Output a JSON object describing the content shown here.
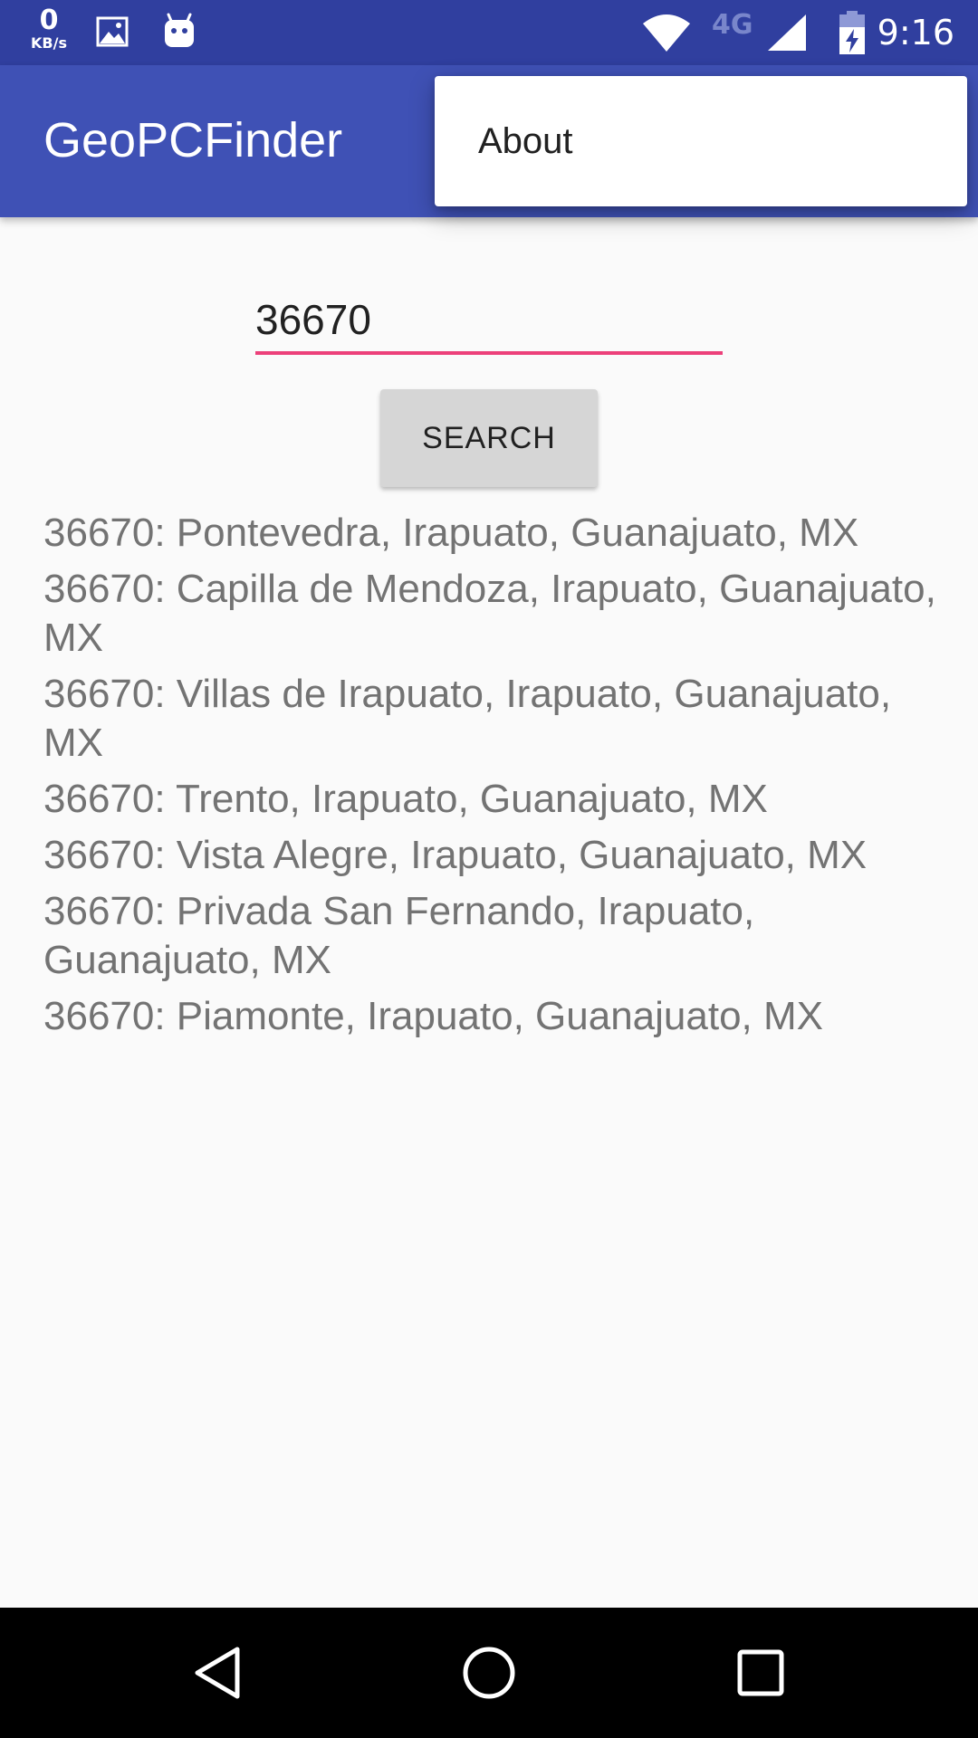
{
  "status_bar": {
    "net_speed_value": "0",
    "net_speed_unit": "KB/s",
    "network_type": "4G",
    "time": "9:16",
    "icons": [
      "gallery-icon",
      "android-icon",
      "wifi-icon",
      "signal-icon",
      "battery-charging-icon"
    ]
  },
  "app_bar": {
    "title": "GeoPCFinder",
    "color": "#3f51b5"
  },
  "overflow_menu": {
    "items": [
      {
        "label": "About"
      }
    ]
  },
  "search": {
    "input_value": "36670",
    "button_label": "SEARCH",
    "accent_color": "#ec407a"
  },
  "results": [
    "36670: Pontevedra, Irapuato, Guanajuato, MX",
    "36670: Capilla de Mendoza, Irapuato, Guanajuato, MX",
    "36670: Villas de Irapuato, Irapuato, Guanajuato, MX",
    "36670: Trento, Irapuato, Guanajuato, MX",
    "36670: Vista Alegre, Irapuato, Guanajuato, MX",
    "36670: Privada San Fernando, Irapuato, Guanajuato, MX",
    "36670: Piamonte, Irapuato, Guanajuato, MX"
  ],
  "nav_bar": {
    "buttons": [
      "back-icon",
      "home-icon",
      "recents-icon"
    ]
  }
}
